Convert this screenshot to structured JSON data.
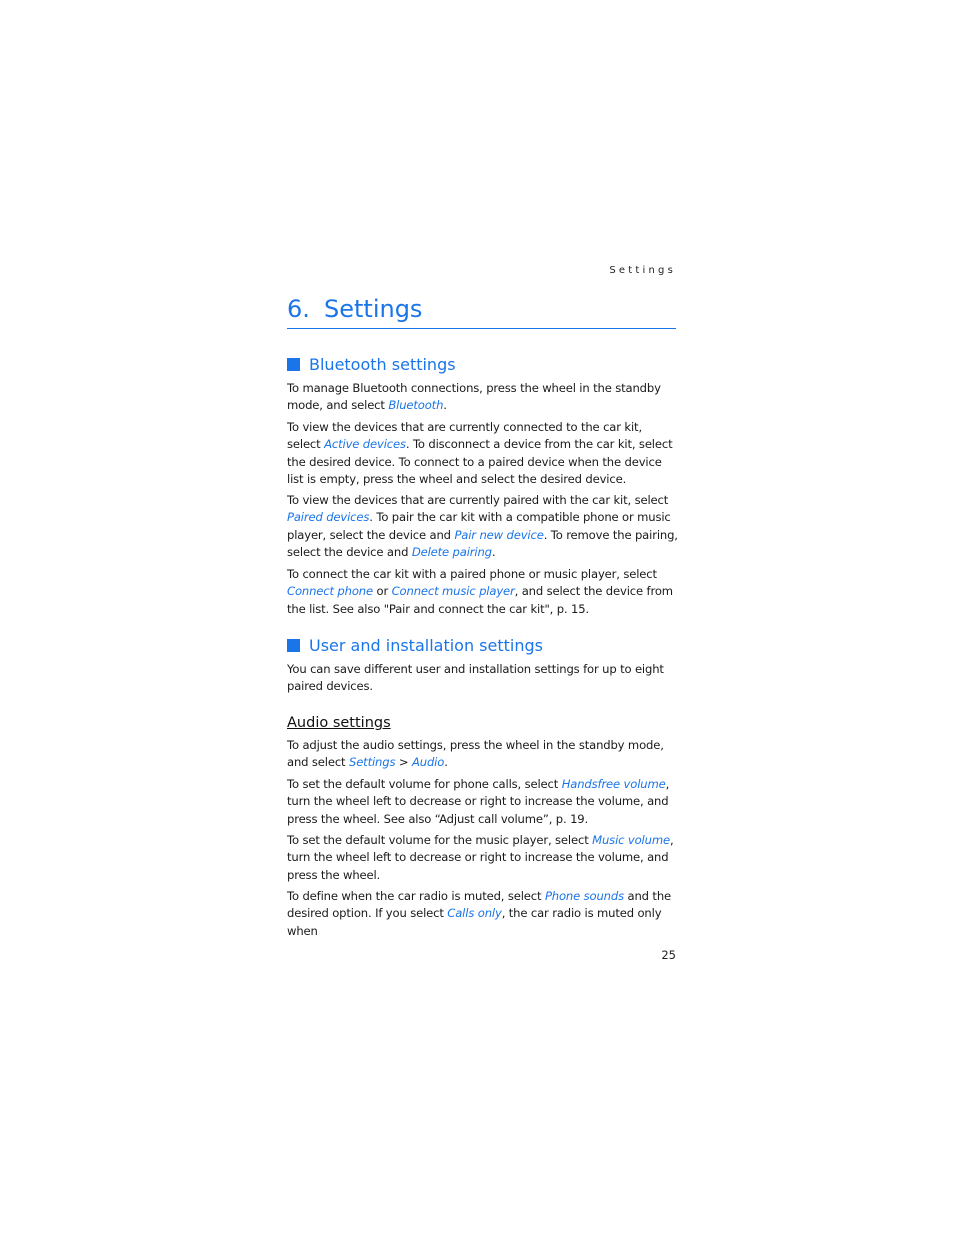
{
  "running_head": "Settings",
  "chapter": {
    "number": "6.",
    "title": "Settings"
  },
  "sections": [
    {
      "title": "Bluetooth settings",
      "paragraphs": [
        [
          "To manage Bluetooth connections, press the wheel in the standby mode, and select ",
          {
            "ref": "Bluetooth"
          },
          "."
        ],
        [
          "To view the devices that are currently connected to the car kit, select ",
          {
            "ref": "Active devices"
          },
          ". To disconnect a device from the car kit, select the desired device. To connect to a paired device when the device list is empty, press the wheel and select the desired device."
        ],
        [
          "To view the devices that are currently paired with the car kit, select ",
          {
            "ref": "Paired devices"
          },
          ". To pair the car kit with a compatible phone or music player, select the device and ",
          {
            "ref": "Pair new device"
          },
          ". To remove the pairing, select the device and ",
          {
            "ref": "Delete pairing"
          },
          "."
        ],
        [
          "To connect the car kit with a paired phone or music player, select ",
          {
            "ref": "Connect phone"
          },
          " or ",
          {
            "ref": "Connect music player"
          },
          ", and select the device from the list. See also \"Pair and connect the car kit\", p. 15."
        ]
      ]
    },
    {
      "title": "User and installation settings",
      "paragraphs": [
        [
          "You can save different user and installation settings for up to eight paired devices."
        ]
      ]
    }
  ],
  "subsection": {
    "title": "Audio settings",
    "paragraphs": [
      [
        "To adjust the audio settings, press the wheel in the standby mode, and select ",
        {
          "ref": "Settings"
        },
        " > ",
        {
          "ref": "Audio"
        },
        "."
      ],
      [
        "To set the default volume for phone calls, select ",
        {
          "ref": "Handsfree volume"
        },
        ", turn the wheel left to decrease or right to increase the volume, and press the wheel. See also “Adjust call volume”, p. 19."
      ],
      [
        "To set the default volume for the music player, select ",
        {
          "ref": "Music volume"
        },
        ", turn the wheel left to decrease or right to increase the volume, and press the wheel."
      ],
      [
        "To define when the car radio is muted, select ",
        {
          "ref": "Phone sounds"
        },
        " and the desired option. If you select ",
        {
          "ref": "Calls only"
        },
        ", the car radio is muted only when"
      ]
    ]
  },
  "page_number": "25",
  "colors": {
    "accent": "#1a75e8",
    "text": "#1a1a1a"
  }
}
